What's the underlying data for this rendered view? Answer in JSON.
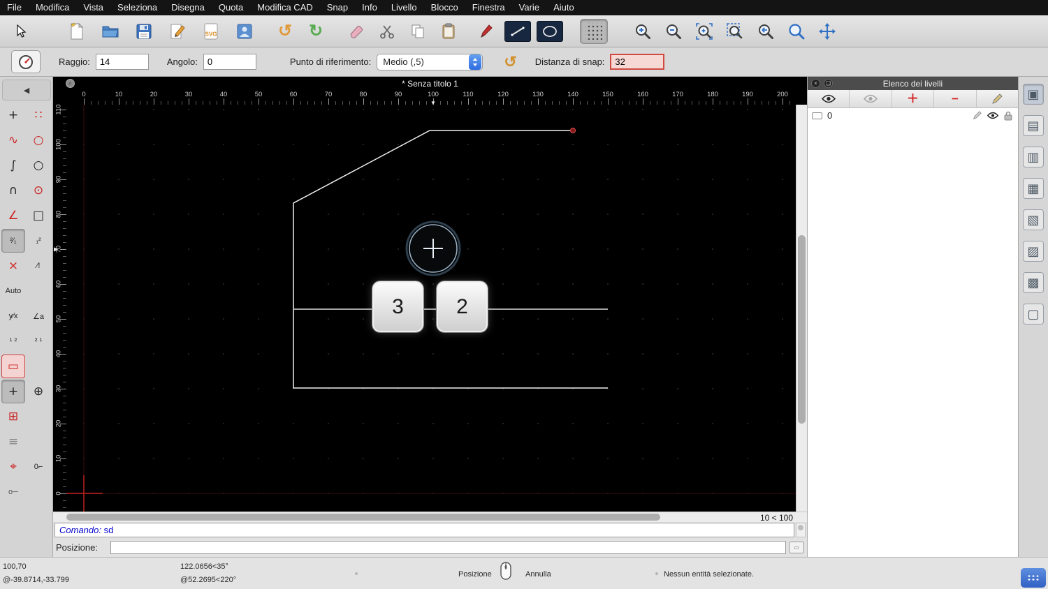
{
  "menu_bar": {
    "items": [
      "File",
      "Modifica",
      "Vista",
      "Seleziona",
      "Disegna",
      "Quota",
      "Modifica CAD",
      "Snap",
      "Info",
      "Livello",
      "Blocco",
      "Finestra",
      "Varie",
      "Aiuto"
    ]
  },
  "main_toolbar": {
    "svg_badge": "SVG",
    "icons": [
      "cursor",
      "new-document",
      "open-folder",
      "save",
      "edit-drawing",
      "svg-export",
      "print-preview",
      "undo",
      "redo",
      "eraser",
      "scissors",
      "copy",
      "paste",
      "draw-pen",
      "line-tool",
      "ellipse-tool",
      "grid-toggle",
      "zoom-in",
      "zoom-out",
      "zoom-auto",
      "zoom-selection",
      "zoom-previous",
      "zoom-window",
      "pan"
    ]
  },
  "options_bar": {
    "radius_label": "Raggio:",
    "radius_value": "14",
    "angle_label": "Angolo:",
    "angle_value": "0",
    "reference_label": "Punto di riferimento:",
    "reference_value": "Medio (,5)",
    "snap_label": "Distanza di snap:",
    "snap_value": "32"
  },
  "left_toolbox": {
    "collapse_glyph": "◀",
    "items": [
      {
        "name": "snap-free-button",
        "glyph": "+",
        "color": "#222"
      },
      {
        "name": "snap-grid-button",
        "glyph": "∷",
        "color": "#cc2222"
      },
      {
        "name": "snap-endpoints-button",
        "glyph": "∿",
        "color": "#cc2222"
      },
      {
        "name": "snap-on-entity-button",
        "glyph": "○",
        "color": "#cc2222"
      },
      {
        "name": "snap-perpendicular-button",
        "glyph": "∫",
        "color": "#222"
      },
      {
        "name": "snap-reference-button",
        "glyph": "○",
        "color": "#222"
      },
      {
        "name": "snap-middle-button",
        "glyph": "∩",
        "color": "#222"
      },
      {
        "name": "snap-center-button",
        "glyph": "⊙",
        "color": "#cc2222"
      },
      {
        "name": "snap-tangential-button",
        "glyph": "∠",
        "color": "#cc2222"
      },
      {
        "name": "snap-corner-button",
        "glyph": "□",
        "color": "#222"
      },
      {
        "name": "restrict-second-entity-button",
        "glyph": "²⁄₁",
        "color": "#222",
        "state": "gray",
        "text": true
      },
      {
        "name": "restrict-both-entities-button",
        "glyph": "₁²",
        "color": "#222",
        "text": true
      },
      {
        "name": "snap-intersection-button",
        "glyph": "×",
        "color": "#cc2222"
      },
      {
        "name": "snap-intersection-manual-button",
        "glyph": "∕!",
        "color": "#222",
        "text": true
      },
      {
        "name": "snap-auto-button",
        "glyph": "Auto",
        "color": "#222",
        "text": true
      },
      {
        "blank": true
      },
      {
        "name": "coordinate-cartesian-button",
        "glyph": "y⁄x",
        "color": "#222",
        "text": true
      },
      {
        "name": "coordinate-polar-button",
        "glyph": "∠a",
        "color": "#222",
        "text": true
      },
      {
        "name": "order-points-12-button",
        "glyph": "¹ ²",
        "color": "#222",
        "text": true
      },
      {
        "name": "order-points-21-button",
        "glyph": "² ¹",
        "color": "#222",
        "text": true
      },
      {
        "name": "restrict-box-button",
        "glyph": "▭",
        "color": "#cc2222",
        "state": "red"
      },
      {
        "blank": true
      },
      {
        "name": "set-position-button",
        "glyph": "+",
        "color": "#222",
        "state": "gray"
      },
      {
        "name": "set-crosshair-button",
        "glyph": "⊕",
        "color": "#222"
      },
      {
        "name": "set-target-button",
        "glyph": "⊞",
        "color": "#cc2222"
      },
      {
        "blank": true
      },
      {
        "name": "construction-lines-button",
        "glyph": "≡",
        "color": "#888"
      },
      {
        "blank": true
      },
      {
        "name": "set-relative-zero-button",
        "glyph": "⌖",
        "color": "#cc2222"
      },
      {
        "name": "relative-zero-0-button",
        "glyph": "0⌐",
        "color": "#222",
        "text": true
      },
      {
        "name": "lock-relative-zero-button",
        "glyph": "o─",
        "color": "#555",
        "text": true
      },
      {
        "blank": true
      }
    ]
  },
  "canvas": {
    "title": "* Senza titolo 1",
    "h_ruler": [
      "0",
      "10",
      "20",
      "30",
      "40",
      "50",
      "60",
      "70",
      "80",
      "90",
      "100",
      "110",
      "120",
      "130",
      "140",
      "150",
      "160",
      "170",
      "180",
      "190",
      "200"
    ],
    "v_ruler": [
      "110",
      "100",
      "90",
      "80",
      "70",
      "60",
      "50",
      "40",
      "30",
      "20",
      "10",
      "0"
    ],
    "zoom_hint": "10 < 100",
    "keycaps": [
      "3",
      "2"
    ]
  },
  "layers_panel": {
    "title": "Elenco dei livelli",
    "layers": [
      {
        "name": "0"
      }
    ]
  },
  "dock": {
    "items": [
      {
        "name": "panel-property-editor-button",
        "glyph": "▣",
        "state": "sel"
      },
      {
        "name": "panel-layer-list-button",
        "glyph": "▤"
      },
      {
        "name": "panel-block-list-button",
        "glyph": "▥"
      },
      {
        "name": "panel-view-list-button",
        "glyph": "▦"
      },
      {
        "name": "panel-selection-filter-button",
        "glyph": "▧"
      },
      {
        "name": "panel-library-browser-button",
        "glyph": "▨"
      },
      {
        "name": "panel-command-line-button",
        "glyph": "▩"
      },
      {
        "name": "panel-clipboard-button",
        "glyph": "▢"
      }
    ]
  },
  "command_area": {
    "prompt_label": "Comando:",
    "command_value": "sd",
    "position_label": "Posizione:"
  },
  "status_bar": {
    "coord_abs": "100,70",
    "coord_rel": "@-39.8714,-33.799",
    "polar_abs": "122.0656<35°",
    "polar_rel": "@52.2695<220°",
    "left_click_label": "Posizione",
    "right_click_label": "Annulla",
    "selection_info": "Nessun entità selezionate."
  },
  "colors": {
    "accent_red": "#cc2222",
    "snap_highlight_bg": "#f6d8d5",
    "snap_highlight_border": "#cf4a42",
    "canvas_bg": "#000000",
    "snap_indicator_blue": "#7a96b3"
  }
}
